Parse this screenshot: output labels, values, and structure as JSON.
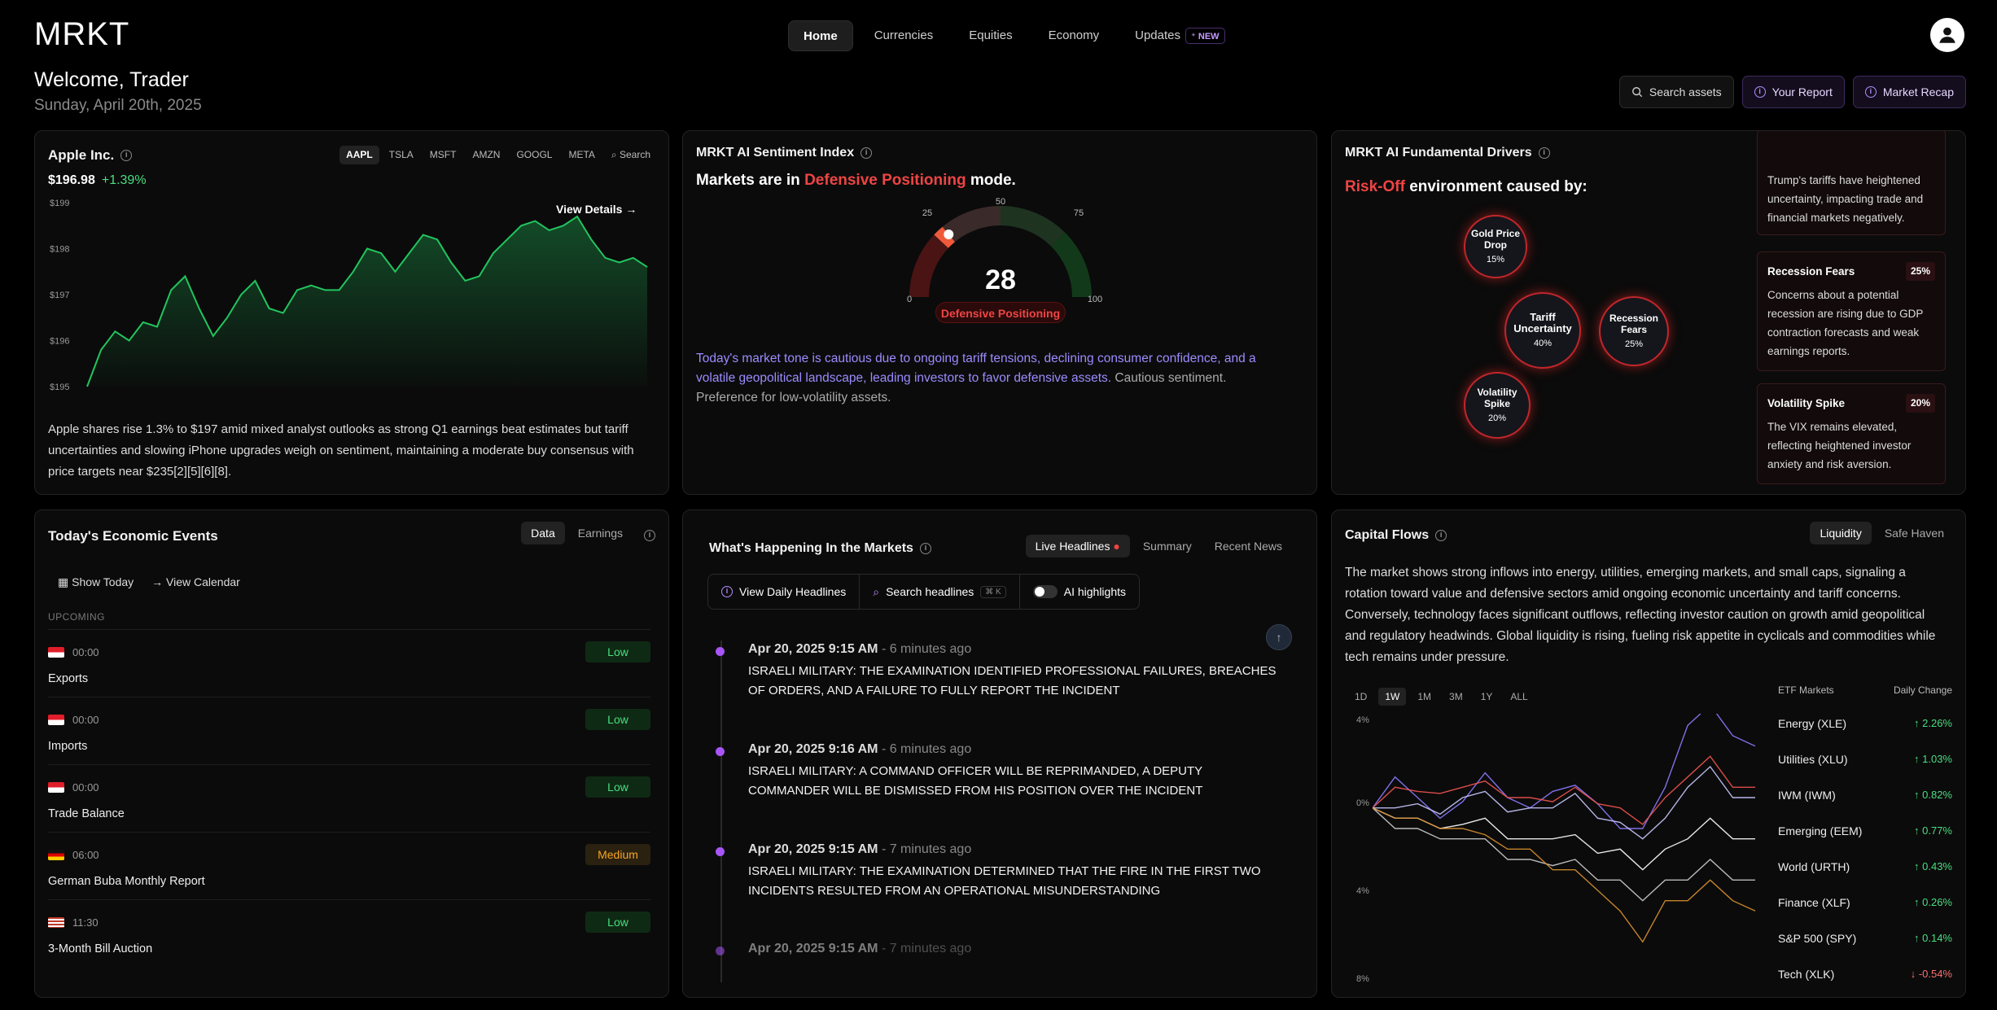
{
  "header": {
    "logo": "MRKT",
    "nav": [
      {
        "label": "Home"
      },
      {
        "label": "Currencies"
      },
      {
        "label": "Equities"
      },
      {
        "label": "Economy"
      },
      {
        "label": "Updates",
        "badge": "NEW"
      }
    ],
    "welcome": "Welcome, Trader",
    "date": "Sunday, April 20th, 2025",
    "actions": {
      "search": "Search assets",
      "report": "Your Report",
      "recap": "Market Recap"
    }
  },
  "stock": {
    "company": "Apple Inc.",
    "tickers": [
      "AAPL",
      "TSLA",
      "MSFT",
      "AMZN",
      "GOOGL",
      "META"
    ],
    "search_label": "Search",
    "price": "$196.98",
    "change": "+1.39%",
    "view_details": "View Details",
    "y_ticks": [
      "$199",
      "$198",
      "$197",
      "$196",
      "$195"
    ],
    "description": "Apple shares rise 1.3% to $197 amid mixed analyst outlooks as strong Q1 earnings beat estimates but tariff uncertainties and slowing iPhone upgrades weigh on sentiment, maintaining a moderate buy consensus with price targets near $235[2][5][6][8].",
    "chart_data": {
      "type": "area",
      "ylim": [
        195,
        199
      ],
      "color": "#22c55e",
      "values": [
        195.0,
        195.8,
        196.2,
        196.0,
        196.4,
        196.3,
        197.1,
        197.4,
        196.7,
        196.1,
        196.5,
        197.0,
        197.3,
        196.7,
        196.6,
        197.1,
        197.2,
        197.1,
        197.1,
        197.5,
        198.0,
        197.9,
        197.5,
        197.9,
        198.3,
        198.2,
        197.7,
        197.3,
        197.4,
        197.9,
        198.2,
        198.5,
        198.6,
        198.4,
        198.5,
        198.7,
        198.2,
        197.8,
        197.7,
        197.8,
        197.6
      ]
    }
  },
  "sentiment": {
    "title": "MRKT AI Sentiment Index",
    "mode_prefix": "Markets are in",
    "mode": "Defensive Positioning",
    "mode_suffix": "mode.",
    "score": "28",
    "gauge_ticks": [
      "0",
      "25",
      "50",
      "75",
      "100"
    ],
    "gauge_value": 28,
    "desc_highlight": "Today's market tone is cautious due to ongoing tariff tensions, declining consumer confidence, and a volatile geopolitical landscape, leading investors to favor defensive assets.",
    "desc_rest": " Cautious sentiment. Preference for low-volatility assets."
  },
  "drivers": {
    "title": "MRKT AI Fundamental Drivers",
    "risk": "Risk-Off",
    "caption": "environment caused by:",
    "bubbles": [
      {
        "label": "Gold Price Drop",
        "pct": "15%"
      },
      {
        "label": "Tariff Uncertainty",
        "pct": "40%"
      },
      {
        "label": "Recession Fears",
        "pct": "25%"
      },
      {
        "label": "Volatility Spike",
        "pct": "20%"
      }
    ],
    "cards": [
      {
        "title": "",
        "pct": "",
        "text": "Trump's tariffs have heightened uncertainty, impacting trade and financial markets negatively."
      },
      {
        "title": "Recession Fears",
        "pct": "25%",
        "text": "Concerns about a potential recession are rising due to GDP contraction forecasts and weak earnings reports."
      },
      {
        "title": "Volatility Spike",
        "pct": "20%",
        "text": "The VIX remains elevated, reflecting heightened investor anxiety and risk aversion."
      }
    ]
  },
  "events": {
    "title": "Today's Economic Events",
    "tabs": [
      "Data",
      "Earnings"
    ],
    "show_today": "Show Today",
    "view_calendar": "View Calendar",
    "upcoming": "UPCOMING",
    "items": [
      {
        "time": "00:00",
        "name": "Exports",
        "impact": "Low",
        "flag": "id"
      },
      {
        "time": "00:00",
        "name": "Imports",
        "impact": "Low",
        "flag": "id"
      },
      {
        "time": "00:00",
        "name": "Trade Balance",
        "impact": "Low",
        "flag": "id"
      },
      {
        "time": "06:00",
        "name": "German Buba Monthly Report",
        "impact": "Medium",
        "flag": "de"
      },
      {
        "time": "11:30",
        "name": "3-Month Bill Auction",
        "impact": "Low",
        "flag": "us"
      }
    ]
  },
  "happening": {
    "title": "What's Happening In the Markets",
    "tabs": [
      "Live Headlines",
      "Summary",
      "Recent News"
    ],
    "tools": {
      "daily": "View Daily Headlines",
      "search": "Search headlines",
      "kbd": "⌘ K",
      "ai": "AI highlights"
    },
    "news": [
      {
        "ts": "Apr 20, 2025 9:15 AM",
        "ago": "- 6 minutes ago",
        "text": "ISRAELI MILITARY: THE EXAMINATION IDENTIFIED PROFESSIONAL FAILURES, BREACHES OF ORDERS, AND A FAILURE TO FULLY REPORT THE INCIDENT"
      },
      {
        "ts": "Apr 20, 2025 9:16 AM",
        "ago": "- 6 minutes ago",
        "text": "ISRAELI MILITARY: A COMMAND OFFICER WILL BE REPRIMANDED, A DEPUTY COMMANDER WILL BE DISMISSED FROM HIS POSITION OVER THE INCIDENT"
      },
      {
        "ts": "Apr 20, 2025 9:15 AM",
        "ago": "- 7 minutes ago",
        "text": "ISRAELI MILITARY: THE EXAMINATION DETERMINED THAT THE FIRE IN THE FIRST TWO INCIDENTS RESULTED FROM AN OPERATIONAL MISUNDERSTANDING"
      },
      {
        "ts": "Apr 20, 2025 9:15 AM",
        "ago": "- 7 minutes ago",
        "text": ""
      }
    ]
  },
  "capital": {
    "title": "Capital Flows",
    "tabs": [
      "Liquidity",
      "Safe Haven"
    ],
    "description": "The market shows strong inflows into energy, utilities, emerging markets, and small caps, signaling a rotation toward value and defensive sectors amid ongoing economic uncertainty and tariff concerns. Conversely, technology faces significant outflows, reflecting investor caution on growth amid geopolitical and regulatory headwinds. Global liquidity is rising, fueling risk appetite in cyclicals and commodities while tech remains under pressure.",
    "ranges": [
      "1D",
      "1W",
      "1M",
      "3M",
      "1Y",
      "ALL"
    ],
    "y_ticks": [
      "4%",
      "0%",
      "4%",
      "8%"
    ],
    "etf_head": "ETF Markets",
    "change_head": "Daily Change",
    "etfs": [
      {
        "name": "Energy (XLE)",
        "change": "↑ 2.26%",
        "dir": "up"
      },
      {
        "name": "Utilities (XLU)",
        "change": "↑ 1.03%",
        "dir": "up"
      },
      {
        "name": "IWM (IWM)",
        "change": "↑ 0.82%",
        "dir": "up"
      },
      {
        "name": "Emerging (EEM)",
        "change": "↑ 0.77%",
        "dir": "up"
      },
      {
        "name": "World (URTH)",
        "change": "↑ 0.43%",
        "dir": "up"
      },
      {
        "name": "Finance (XLF)",
        "change": "↑ 0.26%",
        "dir": "up"
      },
      {
        "name": "S&P 500 (SPY)",
        "change": "↑ 0.14%",
        "dir": "up"
      },
      {
        "name": "Tech (XLK)",
        "change": "↓ -0.54%",
        "dir": "down"
      }
    ],
    "chart_data": {
      "type": "line",
      "ylim": [
        -8,
        4
      ],
      "series": [
        {
          "color": "#8b7bff",
          "values": [
            0,
            1,
            0.5,
            -1,
            0.3,
            1.2,
            0.5,
            -0.5,
            0.8,
            0.6,
            0.2,
            -1.5,
            -1,
            0.5,
            4,
            4.5,
            3.5,
            2.5
          ]
        },
        {
          "color": "#ef5350",
          "values": [
            0,
            0.5,
            0.8,
            0.2,
            1,
            0.8,
            0.5,
            0,
            0.3,
            0.5,
            0.2,
            -0.5,
            -0.8,
            0,
            1.5,
            2,
            1,
            0.5
          ]
        },
        {
          "color": "#c8c8ff",
          "values": [
            0,
            -0.5,
            0.2,
            -0.8,
            0.5,
            0.3,
            -0.2,
            -0.5,
            0,
            0.2,
            -0.5,
            -1.2,
            -1.5,
            -1,
            1,
            1.5,
            0.5,
            0
          ]
        },
        {
          "color": "#ffffff",
          "values": [
            0,
            -1,
            -0.5,
            -1.5,
            -0.8,
            -1,
            -1.5,
            -2,
            -1.5,
            -1.8,
            -2.2,
            -2.5,
            -3,
            -2.5,
            -1.5,
            -1,
            -1.5,
            -2
          ]
        },
        {
          "color": "#cccccc",
          "values": [
            0,
            -1.5,
            -1,
            -2,
            -1.5,
            -2,
            -2.5,
            -3,
            -2.8,
            -3,
            -3.5,
            -4,
            -4.5,
            -4,
            -3.5,
            -3,
            -3.5,
            -4
          ]
        },
        {
          "color": "#d8902c",
          "values": [
            0,
            -1,
            -0.5,
            -1.5,
            -1,
            -1.8,
            -2,
            -2.5,
            -3,
            -3.5,
            -4,
            -5.5,
            -6.5,
            -5,
            -4.5,
            -4,
            -4.5,
            -5.5
          ]
        }
      ]
    }
  }
}
